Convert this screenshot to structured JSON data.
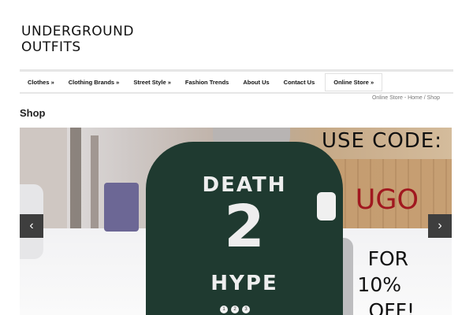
{
  "site": {
    "logo_line1": "UNDERGROUND",
    "logo_line2": "OUTFITS"
  },
  "nav": {
    "items": [
      {
        "label": "Clothes »"
      },
      {
        "label": "Clothing Brands »"
      },
      {
        "label": "Street Style »"
      },
      {
        "label": "Fashion Trends"
      },
      {
        "label": "About Us"
      },
      {
        "label": "Contact Us"
      },
      {
        "label": "Online Store »"
      }
    ]
  },
  "breadcrumb": {
    "items": [
      "Online Store",
      "Home",
      "Shop"
    ],
    "sep1": " - ",
    "sep2": " / "
  },
  "page": {
    "title": "Shop"
  },
  "slider": {
    "shirt_line1": "DEATH",
    "shirt_line2": "2",
    "shirt_line3": "HYPE",
    "promo_line1": "USE CODE:",
    "promo_code": "UGO",
    "promo_line3": "FOR",
    "promo_line4": "10%",
    "promo_line5": "OFF!",
    "prev_icon": "‹",
    "next_icon": "›",
    "dots": [
      "1",
      "2",
      "3"
    ],
    "colors": {
      "shirt": "#1f3a30",
      "promo_code": "#a1181f",
      "arrow_bg": "#3e3e3e"
    }
  }
}
